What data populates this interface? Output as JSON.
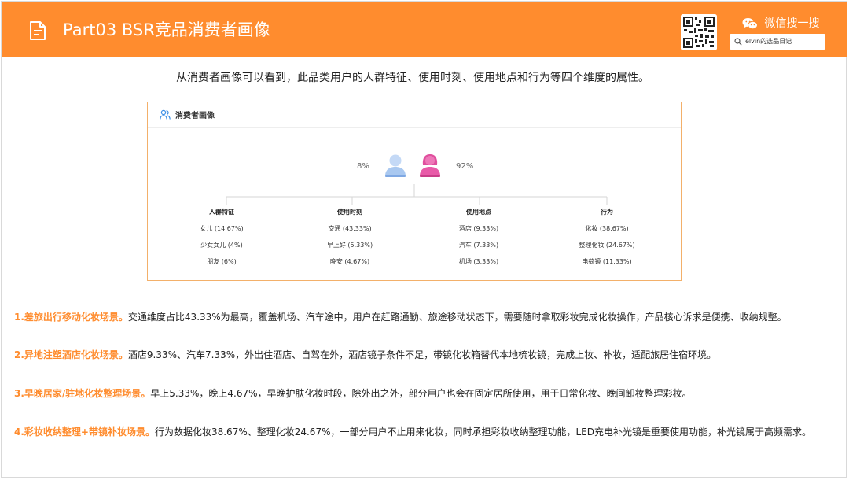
{
  "header": {
    "title": "Part03 BSR竞品消费者画像",
    "wechat_label": "微信搜一搜",
    "search_text": "elvin的选品日记"
  },
  "intro": "从消费者画像可以看到，此品类用户的人群特征、使用时刻、使用地点和行为等四个维度的属性。",
  "card": {
    "title": "消费者画像",
    "male_pct": "8%",
    "female_pct": "92%",
    "columns": [
      {
        "label": "人群特征",
        "items": [
          "女儿 (14.67%)",
          "少女女儿 (4%)",
          "朋友 (6%)"
        ]
      },
      {
        "label": "使用时刻",
        "items": [
          "交通 (43.33%)",
          "早上好 (5.33%)",
          "晚安 (4.67%)"
        ]
      },
      {
        "label": "使用地点",
        "items": [
          "酒店 (9.33%)",
          "汽车 (7.33%)",
          "机场 (3.33%)"
        ]
      },
      {
        "label": "行为",
        "items": [
          "化妆 (38.67%)",
          "整理化妆 (24.67%)",
          "电荷镜 (11.33%)"
        ]
      }
    ]
  },
  "paragraphs": [
    {
      "highlight": "1.差旅出行移动化妆场景。",
      "text": "交通维度占比43.33%为最高，覆盖机场、汽车途中，用户在赶路通勤、旅途移动状态下，需要随时拿取彩妆完成化妆操作，产品核心诉求是便携、收纳规整。"
    },
    {
      "highlight": "2.异地注塑酒店化妆场景。",
      "text": "酒店9.33%、汽车7.33%，外出住酒店、自驾在外，酒店镜子条件不足，带镜化妆箱替代本地梳妆镜，完成上妆、补妆，适配旅居住宿环境。"
    },
    {
      "highlight": "3.早晚居家/驻地化妆整理场景。",
      "text": "早上5.33%，晚上4.67%，早晚护肤化妆时段，除外出之外，部分用户也会在固定居所使用，用于日常化妆、晚间卸妆整理彩妆。"
    },
    {
      "highlight": "4.彩妆收纳整理+带镜补妆场景。",
      "text": "行为数据化妆38.67%、整理化妆24.67%，一部分用户不止用来化妆，同时承担彩妆收纳整理功能，LED充电补光镜是重要使用功能，补光镜属于高频需求。"
    }
  ],
  "colors": {
    "brand_orange": "#ff8c2e",
    "male_blue": "#b9d3f5",
    "female_pink": "#e85aa8"
  }
}
